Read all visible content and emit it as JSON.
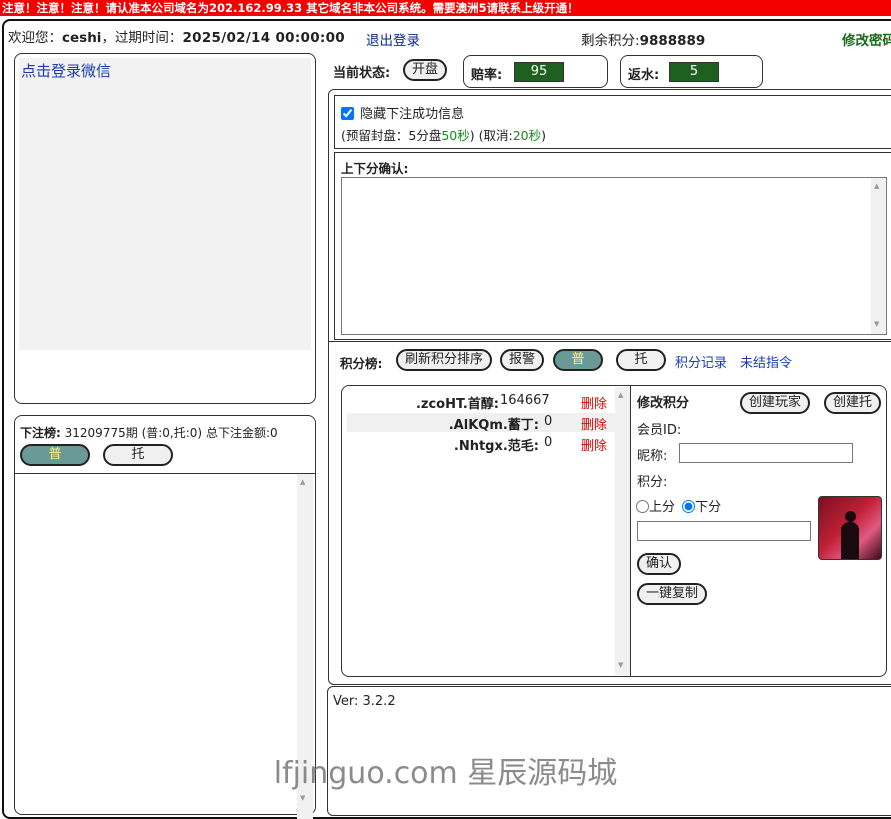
{
  "notice": "注意！注意！注意！请认准本公司域名为202.162.99.33 其它域名非本公司系统。需要澳洲5请联系上级开通！",
  "header": {
    "welcome_label": "欢迎您：",
    "username": "ceshi",
    "expire_label": "，过期时间：",
    "expire_time": "2025/02/14 00:00:00",
    "logout": "退出登录",
    "points_label": "剩余积分:",
    "points_value": "9888889",
    "change_password": "修改密码"
  },
  "wechat": {
    "login_link": "点击登录微信"
  },
  "bet_board": {
    "title": "下注榜:",
    "period": "31209775期",
    "counts": "(普:0,托:0)",
    "total_label": "总下注金额:0",
    "tab_normal": "普",
    "tab_shill": "托"
  },
  "status": {
    "label": "当前状态:",
    "open_button": "开盘",
    "odds_label": "赔率:",
    "odds_value": "95",
    "rebate_label": "返水:",
    "rebate_value": "5"
  },
  "settings": {
    "hide_success_label": "隐藏下注成功信息",
    "hide_success_checked": true,
    "reserve_prefix": "(预留封盘：",
    "reserve_text": "5分盘",
    "reserve_seconds": "50秒",
    "cancel_prefix": "(取消:",
    "cancel_seconds": "20秒",
    "close_paren": ")"
  },
  "confirm": {
    "label": "上下分确认:"
  },
  "ranking": {
    "label": "积分榜:",
    "refresh_button": "刷新积分排序",
    "alarm_button": "报警",
    "tab_normal": "普",
    "tab_shill": "托",
    "records_link": "积分记录",
    "pending_link": "未结指令",
    "delete_label": "删除",
    "rows": [
      {
        "name": ".zcoHT.首醇:",
        "score": "164667"
      },
      {
        "name": ".AlKQm.蓄丁:",
        "score": "0"
      },
      {
        "name": ".Nhtgx.范毛:",
        "score": "0"
      }
    ]
  },
  "edit": {
    "title": "修改积分",
    "create_player": "创建玩家",
    "create_shill": "创建托",
    "member_id_label": "会员ID:",
    "nickname_label": "昵称:",
    "points_label": "积分:",
    "up_label": "上分",
    "down_label": "下分",
    "down_checked": true,
    "confirm_button": "确认",
    "copy_button": "一键复制"
  },
  "footer": {
    "version": "Ver: 3.2.2"
  },
  "watermark": "lfjinguo.com 星辰源码城",
  "colors": {
    "notice_bg": "#f40000",
    "selected_tab": "#6a9a98",
    "odds_bg": "#1f5f1f",
    "delete_red": "#e00000",
    "link_blue": "#0a2a8a",
    "green_text": "#1a8a1a"
  }
}
